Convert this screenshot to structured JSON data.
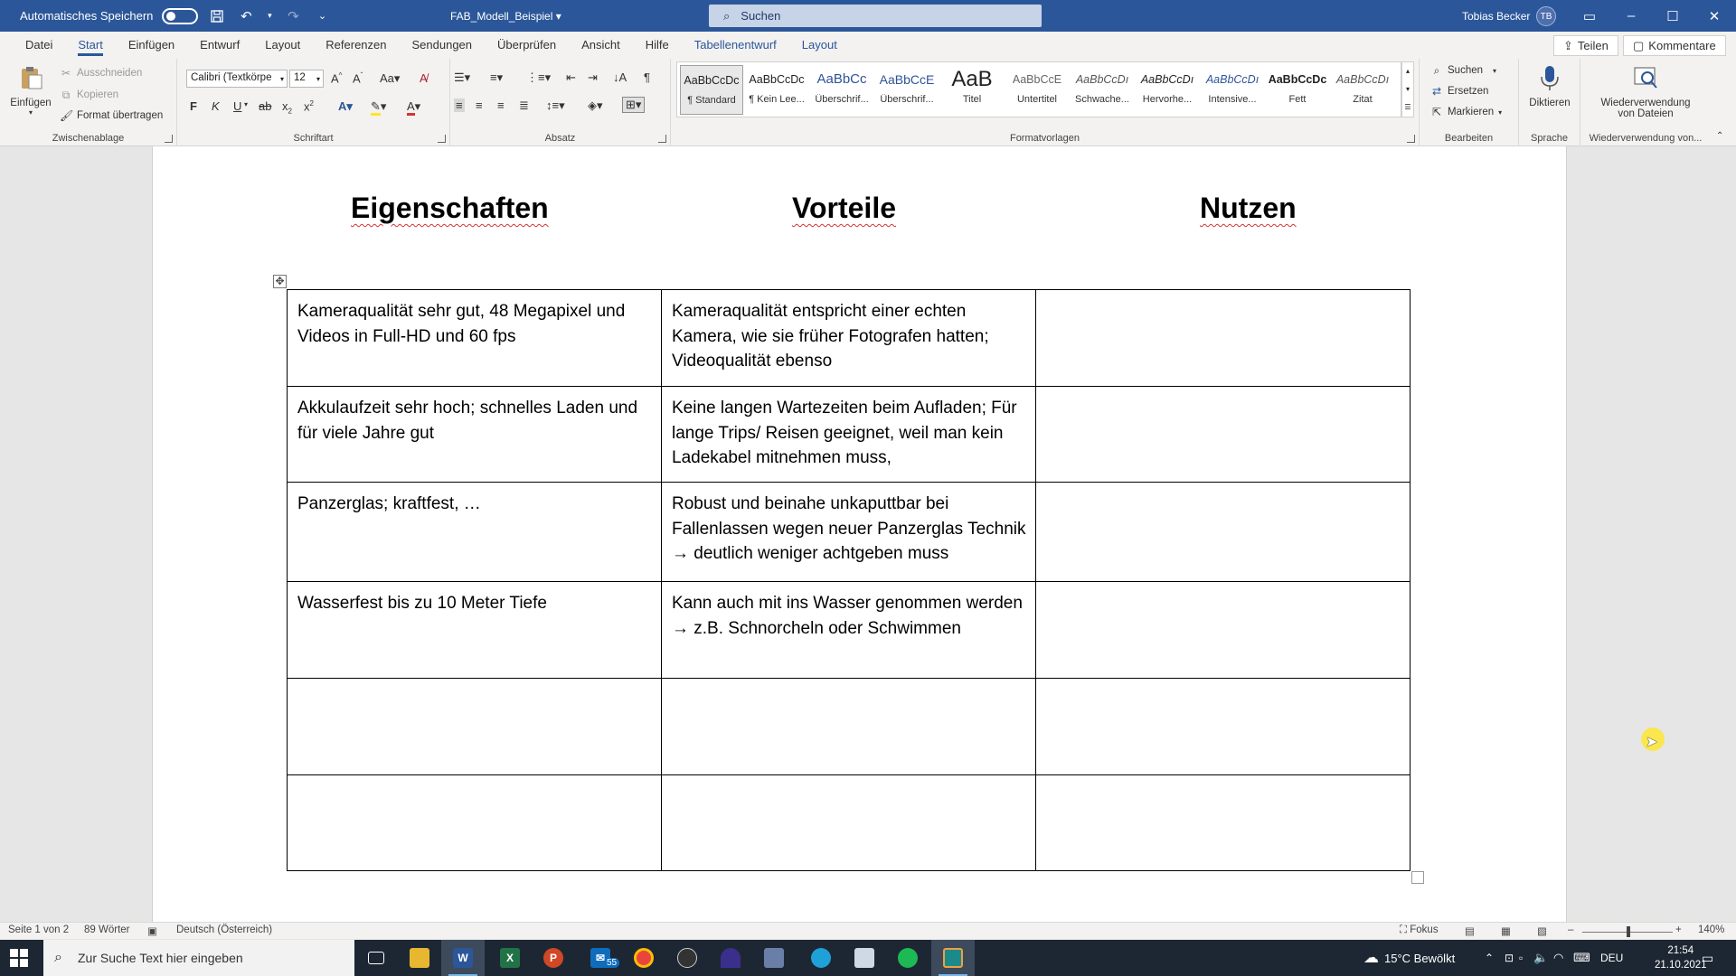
{
  "titlebar": {
    "autosave_label": "Automatisches Speichern",
    "doc_title": "FAB_Modell_Beispiel",
    "search_label": "Suchen",
    "user_name": "Tobias Becker",
    "user_initials": "TB"
  },
  "ribbon_tabs": [
    "Datei",
    "Start",
    "Einfügen",
    "Entwurf",
    "Layout",
    "Referenzen",
    "Sendungen",
    "Überprüfen",
    "Ansicht",
    "Hilfe",
    "Tabellenentwurf",
    "Layout"
  ],
  "active_tab": "Start",
  "share_label": "Teilen",
  "comments_label": "Kommentare",
  "clipboard": {
    "paste_label": "Einfügen",
    "cut_label": "Ausschneiden",
    "copy_label": "Kopieren",
    "format_painter_label": "Format übertragen",
    "group_label": "Zwischenablage"
  },
  "font": {
    "family": "Calibri (Textkörpe",
    "size": "12",
    "group_label": "Schriftart"
  },
  "paragraph": {
    "group_label": "Absatz"
  },
  "styles": {
    "group_label": "Formatvorlagen",
    "items": [
      {
        "preview": "AaBbCcDc",
        "name": "¶ Standard"
      },
      {
        "preview": "AaBbCcDc",
        "name": "¶ Kein Lee..."
      },
      {
        "preview": "AaBbCc",
        "name": "Überschrif..."
      },
      {
        "preview": "AaBbCcE",
        "name": "Überschrif..."
      },
      {
        "preview": "AaB",
        "name": "Titel"
      },
      {
        "preview": "AaBbCcE",
        "name": "Untertitel"
      },
      {
        "preview": "AaBbCcDı",
        "name": "Schwache..."
      },
      {
        "preview": "AaBbCcDı",
        "name": "Hervorhe..."
      },
      {
        "preview": "AaBbCcDı",
        "name": "Intensive..."
      },
      {
        "preview": "AaBbCcDc",
        "name": "Fett"
      },
      {
        "preview": "AaBbCcDı",
        "name": "Zitat"
      }
    ]
  },
  "editing": {
    "group_label": "Bearbeiten",
    "find_label": "Suchen",
    "replace_label": "Ersetzen",
    "select_label": "Markieren"
  },
  "voice": {
    "dictate_label": "Diktieren",
    "group_label": "Sprache"
  },
  "reuse": {
    "label_line1": "Wiederverwendung",
    "label_line2": "von Dateien",
    "group_label": "Wiederverwendung von..."
  },
  "document": {
    "headings": [
      "Eigenschaften",
      "Vorteile",
      "Nutzen"
    ],
    "rows": [
      [
        "Kameraqualität sehr gut, 48 Megapixel und Videos in Full-HD und 60 fps",
        "Kameraqualität entspricht einer echten Kamera, wie sie früher Fotografen hatten; Videoqualität ebenso",
        ""
      ],
      [
        "Akkulaufzeit sehr hoch; schnelles Laden und für viele Jahre gut",
        "Keine langen Wartezeiten beim Aufladen; Für lange Trips/ Reisen geeignet, weil man kein Ladekabel mitnehmen muss,",
        ""
      ],
      [
        "Panzerglas; kraftfest, …",
        "Robust und beinahe unkaputtbar bei Fallenlassen wegen neuer Panzerglas Technik → deutlich weniger achtgeben muss",
        ""
      ],
      [
        "Wasserfest bis zu 10 Meter Tiefe",
        "Kann auch mit ins Wasser genommen werden → z.B. Schnorcheln oder Schwimmen",
        ""
      ],
      [
        "",
        "",
        ""
      ],
      [
        "",
        "",
        ""
      ]
    ]
  },
  "statusbar": {
    "page": "Seite 1 von 2",
    "words": "89 Wörter",
    "language": "Deutsch (Österreich)",
    "focus": "Fokus",
    "zoom": "140%"
  },
  "taskbar": {
    "search_placeholder": "Zur Suche Text hier eingeben",
    "mail_badge": "55",
    "weather": "15°C  Bewölkt",
    "lang": "DEU",
    "time": "21:54",
    "date": "21.10.2021"
  },
  "colors": {
    "word_blue": "#2b579a",
    "excel_green": "#217346",
    "powerpoint_red": "#d24726",
    "spell_underline": "#d13438",
    "cursor_highlight": "#ffe628"
  }
}
